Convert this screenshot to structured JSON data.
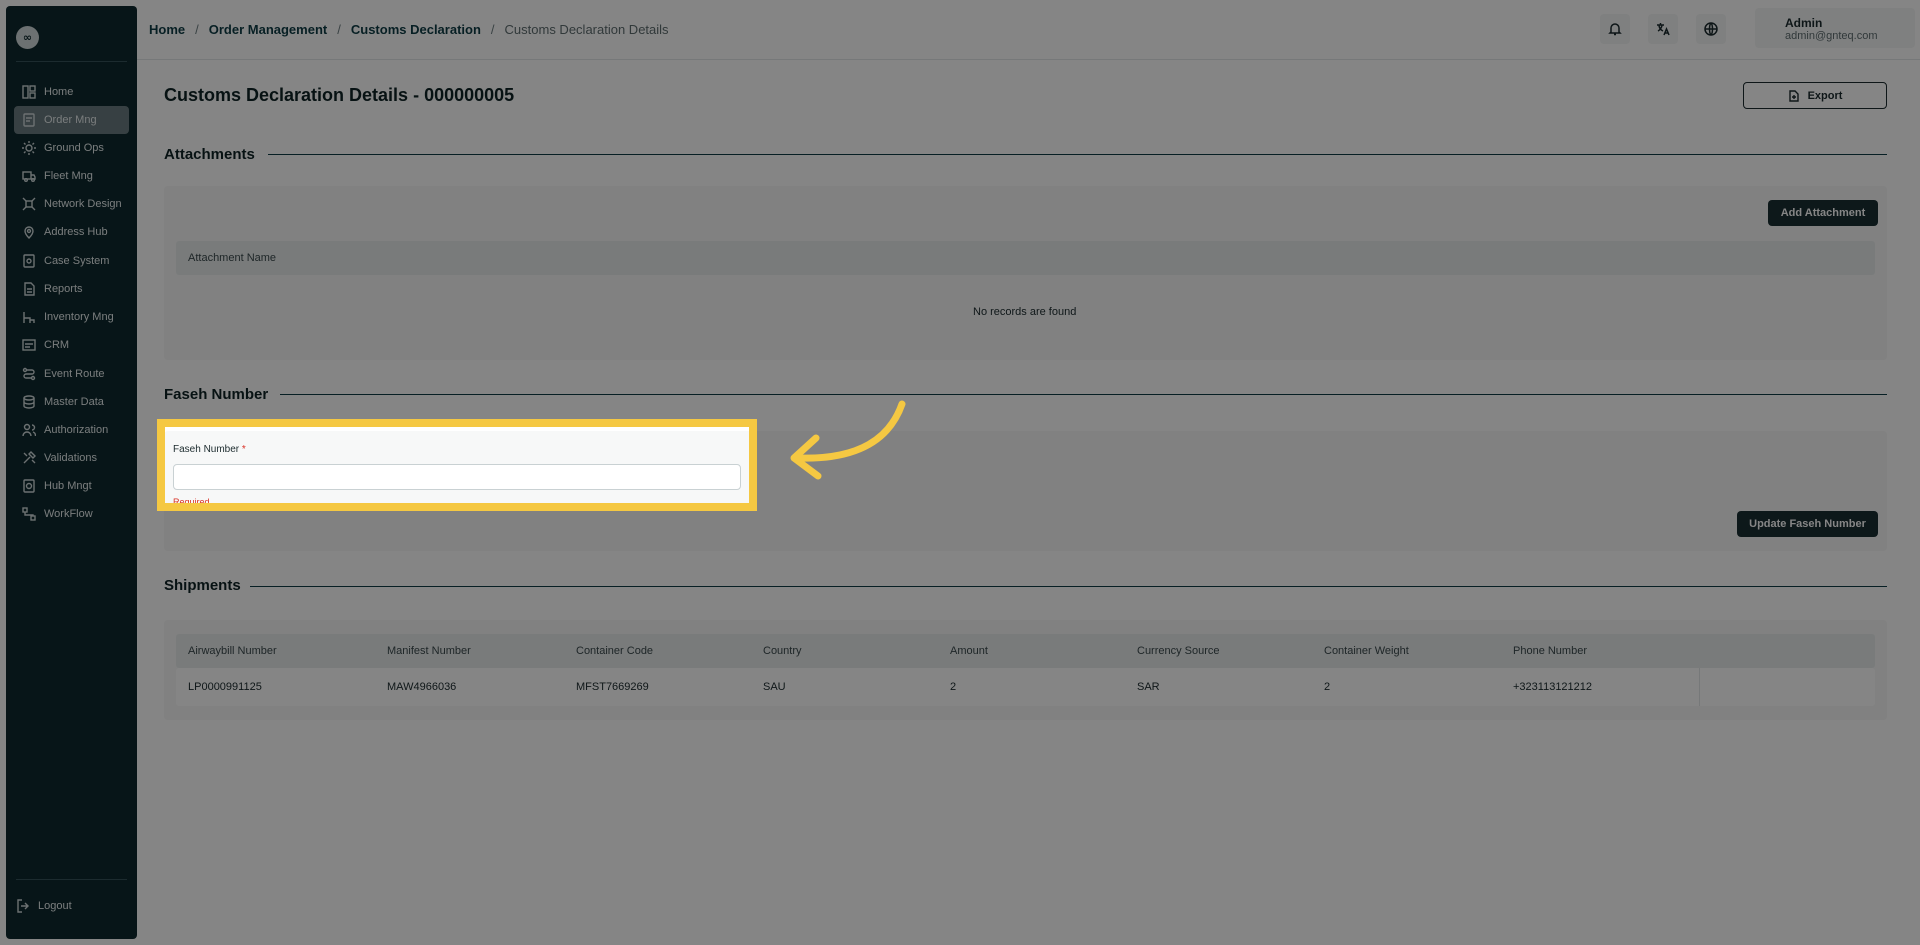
{
  "app": {
    "logo_glyph": "∞"
  },
  "breadcrumb": [
    {
      "label": "Home"
    },
    {
      "label": "Order Management"
    },
    {
      "label": "Customs Declaration"
    }
  ],
  "breadcrumb_current": "Customs Declaration Details",
  "breadcrumb_separator": "/",
  "user": {
    "name": "Admin",
    "email": "admin@gnteq.com"
  },
  "header_icons": [
    "bell-icon",
    "translate-icon",
    "globe-icon"
  ],
  "sidebar": {
    "items": [
      {
        "label": "Home",
        "icon": "grid-icon"
      },
      {
        "label": "Order Mng",
        "icon": "order-icon",
        "active": true
      },
      {
        "label": "Ground Ops",
        "icon": "sun-icon"
      },
      {
        "label": "Fleet Mng",
        "icon": "truck-icon"
      },
      {
        "label": "Network Design",
        "icon": "network-icon"
      },
      {
        "label": "Address Hub",
        "icon": "pin-icon"
      },
      {
        "label": "Case System",
        "icon": "case-icon"
      },
      {
        "label": "Reports",
        "icon": "report-icon"
      },
      {
        "label": "Inventory Mng",
        "icon": "inventory-icon"
      },
      {
        "label": "CRM",
        "icon": "crm-icon"
      },
      {
        "label": "Event Route",
        "icon": "route-icon"
      },
      {
        "label": "Master Data",
        "icon": "database-icon"
      },
      {
        "label": "Authorization",
        "icon": "users-icon"
      },
      {
        "label": "Validations",
        "icon": "tools-icon"
      },
      {
        "label": "Hub Mngt",
        "icon": "hub-icon"
      },
      {
        "label": "WorkFlow",
        "icon": "workflow-icon"
      }
    ],
    "logout": "Logout"
  },
  "page": {
    "title": "Customs Declaration Details - 000000005",
    "export_label": "Export"
  },
  "attachments": {
    "title": "Attachments",
    "add_label": "Add Attachment",
    "column": "Attachment Name",
    "empty": "No records are found"
  },
  "faseh": {
    "title": "Faseh Number",
    "field_label": "Faseh Number",
    "required_mark": "*",
    "value": "",
    "error": "Required",
    "update_label": "Update Faseh Number"
  },
  "shipments": {
    "title": "Shipments",
    "columns": [
      "Airwaybill Number",
      "Manifest Number",
      "Container Code",
      "Country",
      "Amount",
      "Currency Source",
      "Container Weight",
      "Phone Number"
    ],
    "rows": [
      [
        "LP0000991125",
        "MAW4966036",
        "MFST7669269",
        "SAU",
        "2",
        "SAR",
        "2",
        "+323113121212"
      ]
    ]
  },
  "overlay": {
    "highlight_color": "#f5c842",
    "dim": "rgba(0,0,0,0.48)"
  }
}
